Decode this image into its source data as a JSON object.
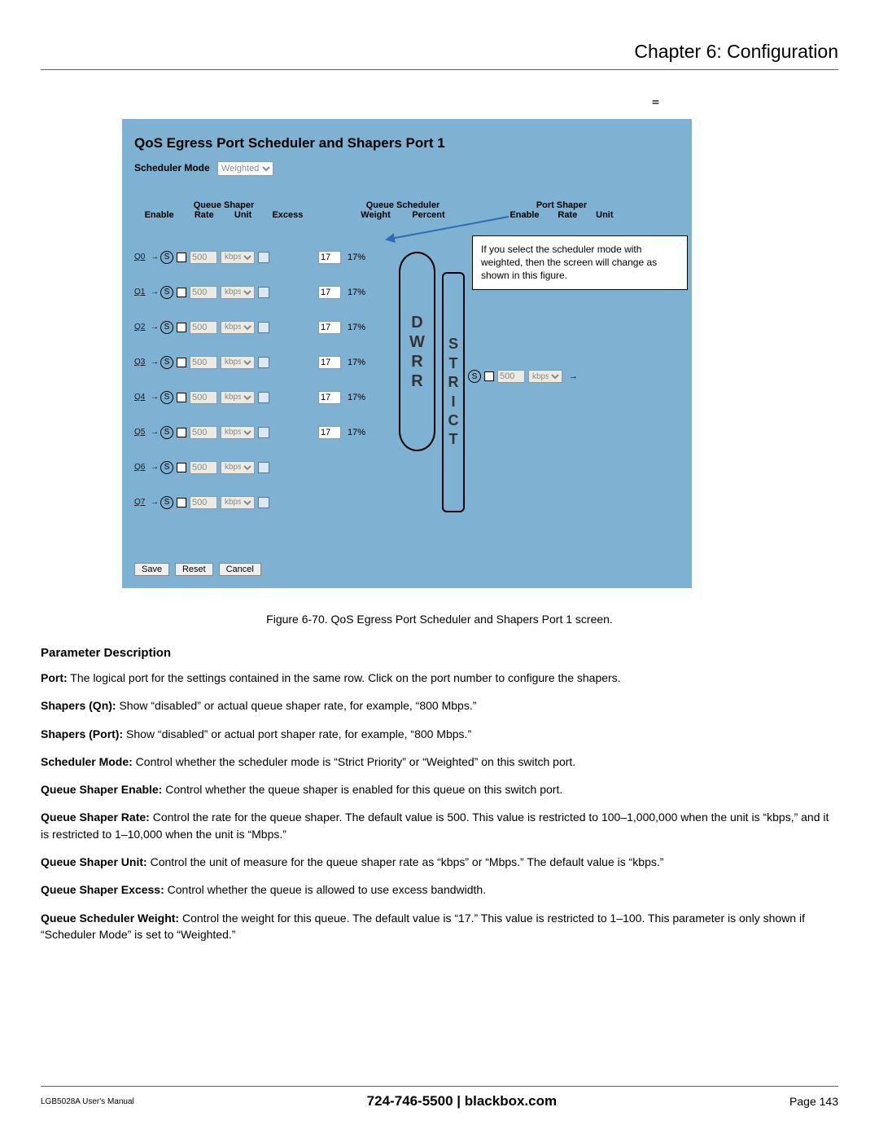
{
  "header": {
    "chapter_title": "Chapter 6: Configuration"
  },
  "misc": {
    "equals_sign": "=",
    "s_label": "S"
  },
  "ui": {
    "heading": "QoS Egress Port Scheduler and Shapers  Port 1",
    "scheduler_mode": {
      "label": "Scheduler Mode",
      "value": "Weighted"
    },
    "groups": {
      "queue_shaper": {
        "title": "Queue Shaper",
        "cols": {
          "enable": "Enable",
          "rate": "Rate",
          "unit": "Unit",
          "excess": "Excess"
        }
      },
      "queue_scheduler": {
        "title": "Queue Scheduler",
        "cols": {
          "weight": "Weight",
          "percent": "Percent"
        }
      },
      "port_shaper": {
        "title": "Port Shaper",
        "cols": {
          "enable": "Enable",
          "rate": "Rate",
          "unit": "Unit"
        }
      }
    },
    "queues": [
      {
        "label": "Q0",
        "rate": "500",
        "unit": "kbps",
        "weight": "17",
        "percent": "17%"
      },
      {
        "label": "Q1",
        "rate": "500",
        "unit": "kbps",
        "weight": "17",
        "percent": "17%"
      },
      {
        "label": "Q2",
        "rate": "500",
        "unit": "kbps",
        "weight": "17",
        "percent": "17%"
      },
      {
        "label": "Q3",
        "rate": "500",
        "unit": "kbps",
        "weight": "17",
        "percent": "17%"
      },
      {
        "label": "Q4",
        "rate": "500",
        "unit": "kbps",
        "weight": "17",
        "percent": "17%"
      },
      {
        "label": "Q5",
        "rate": "500",
        "unit": "kbps",
        "weight": "17",
        "percent": "17%"
      },
      {
        "label": "Q6",
        "rate": "500",
        "unit": "kbps"
      },
      {
        "label": "Q7",
        "rate": "500",
        "unit": "kbps"
      }
    ],
    "dwrr_letters": [
      "D",
      "W",
      "R",
      "R"
    ],
    "strict_letters": [
      "S",
      "T",
      "R",
      "I",
      "C",
      "T"
    ],
    "port_shaper_row": {
      "rate": "500",
      "unit": "kbps"
    },
    "callout": "If you select the scheduler mode with weighted, then the screen will change as shown in this figure.",
    "buttons": {
      "save": "Save",
      "reset": "Reset",
      "cancel": "Cancel"
    }
  },
  "figure_caption": "Figure 6-70. QoS Egress Port Scheduler and Shapers Port 1 screen.",
  "param": {
    "heading": "Parameter Description",
    "items": [
      {
        "label": "Port:",
        "text": " The logical port for the settings contained in the same row. Click on the port number to configure the shapers."
      },
      {
        "label": "Shapers (Qn):",
        "text": " Show “disabled” or actual queue shaper rate, for example, “800 Mbps.”"
      },
      {
        "label": "Shapers (Port):",
        "text": " Show “disabled” or actual port shaper rate, for example, “800 Mbps.”"
      },
      {
        "label": "Scheduler Mode:",
        "text": " Control whether the scheduler mode is “Strict Priority” or “Weighted” on this switch port."
      },
      {
        "label": "Queue Shaper Enable:",
        "text": " Control whether the queue shaper is enabled for this queue on this switch port."
      },
      {
        "label": "Queue Shaper Rate:",
        "text": " Control the rate for the queue shaper. The default value is 500. This value is restricted to 100–1,000,000 when the unit is “kbps,” and it is restricted to 1–10,000 when the unit is “Mbps.”"
      },
      {
        "label": "Queue Shaper Unit:",
        "text": " Control the unit of measure for the queue shaper rate as “kbps” or “Mbps.” The default value is “kbps.”"
      },
      {
        "label": "Queue Shaper Excess:",
        "text": " Control whether the queue is allowed to use excess bandwidth."
      },
      {
        "label": "Queue Scheduler Weight:",
        "text": " Control the weight for this queue. The default value is “17.” This value is restricted to 1–100. This parameter is only shown if “Scheduler Mode” is set to “Weighted.”"
      }
    ]
  },
  "footer": {
    "left": "LGB5028A User's Manual",
    "center": "724-746-5500   |   blackbox.com",
    "right": "Page 143"
  }
}
